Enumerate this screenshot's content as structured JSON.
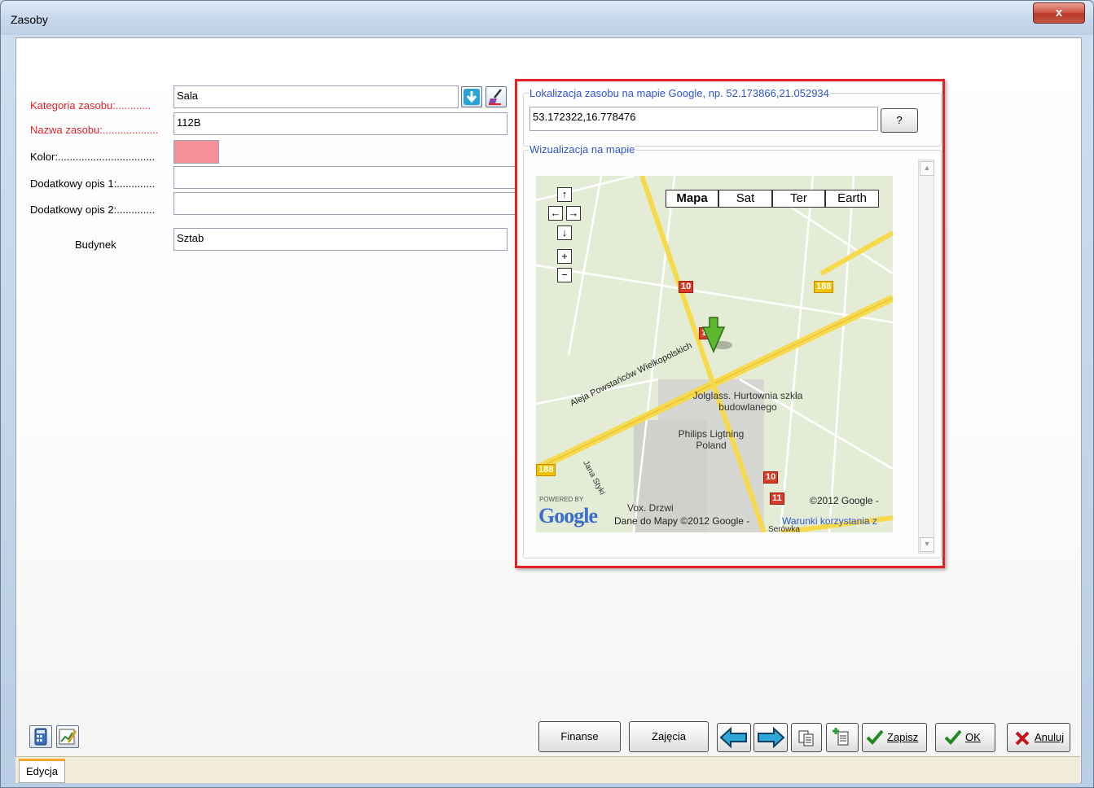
{
  "window": {
    "title": "Zasoby",
    "close_symbol": "x"
  },
  "form": {
    "category": {
      "label": "Kategoria zasobu:............",
      "value": "Sala"
    },
    "name": {
      "label": "Nazwa zasobu:...................",
      "value": "112B"
    },
    "color": {
      "label": "Kolor:.................................",
      "value": "#f4909a"
    },
    "desc1": {
      "label": "Dodatkowy opis 1:.............",
      "value": ""
    },
    "desc2": {
      "label": "Dodatkowy opis 2:.............",
      "value": ""
    },
    "building": {
      "label": "Budynek",
      "value": "Sztab"
    }
  },
  "map_panel": {
    "location_group_label": "Lokalizacja zasobu na mapie Google, np. 52.173866,21.052934",
    "coordinates_value": "53.172322,16.778476",
    "help_button": "?",
    "visualization_group_label": "Wizualizacja na mapie",
    "map_types": [
      "Mapa",
      "Sat",
      "Ter",
      "Earth"
    ],
    "selected_map_type": "Mapa",
    "nav_controls": {
      "up": "↑",
      "left": "←",
      "right": "→",
      "down": "↓",
      "zoom_in": "+",
      "zoom_out": "−"
    },
    "route_shields": [
      "10",
      "188",
      "1",
      "10",
      "11",
      "188"
    ],
    "street_label": "Aleja Powstańców Wielkopolskich",
    "street_label_2": "Jana Styki",
    "place_labels": [
      "Jolglass. Hurtownia szkła budowlanego",
      "Philips Ligtning Poland",
      "Vox. Drzwi",
      "Serówka"
    ],
    "powered_by": "POWERED BY",
    "google_logo": "Google",
    "copyright": "©2012 Google -",
    "data_credit": "Dane do Mapy ©2012 Google -",
    "terms_link": "Warunki korzystania z",
    "colors": {
      "map_bg": "#e4ecd6",
      "road_yellow": "#f7d94c",
      "marker_green": "#5cb82e"
    }
  },
  "bottom": {
    "finance_button": "Finanse",
    "classes_button": "Zajęcia",
    "save_button": "Zapisz",
    "ok_button": "OK",
    "cancel_button": "Anuluj",
    "tab_label": "Edycja"
  }
}
